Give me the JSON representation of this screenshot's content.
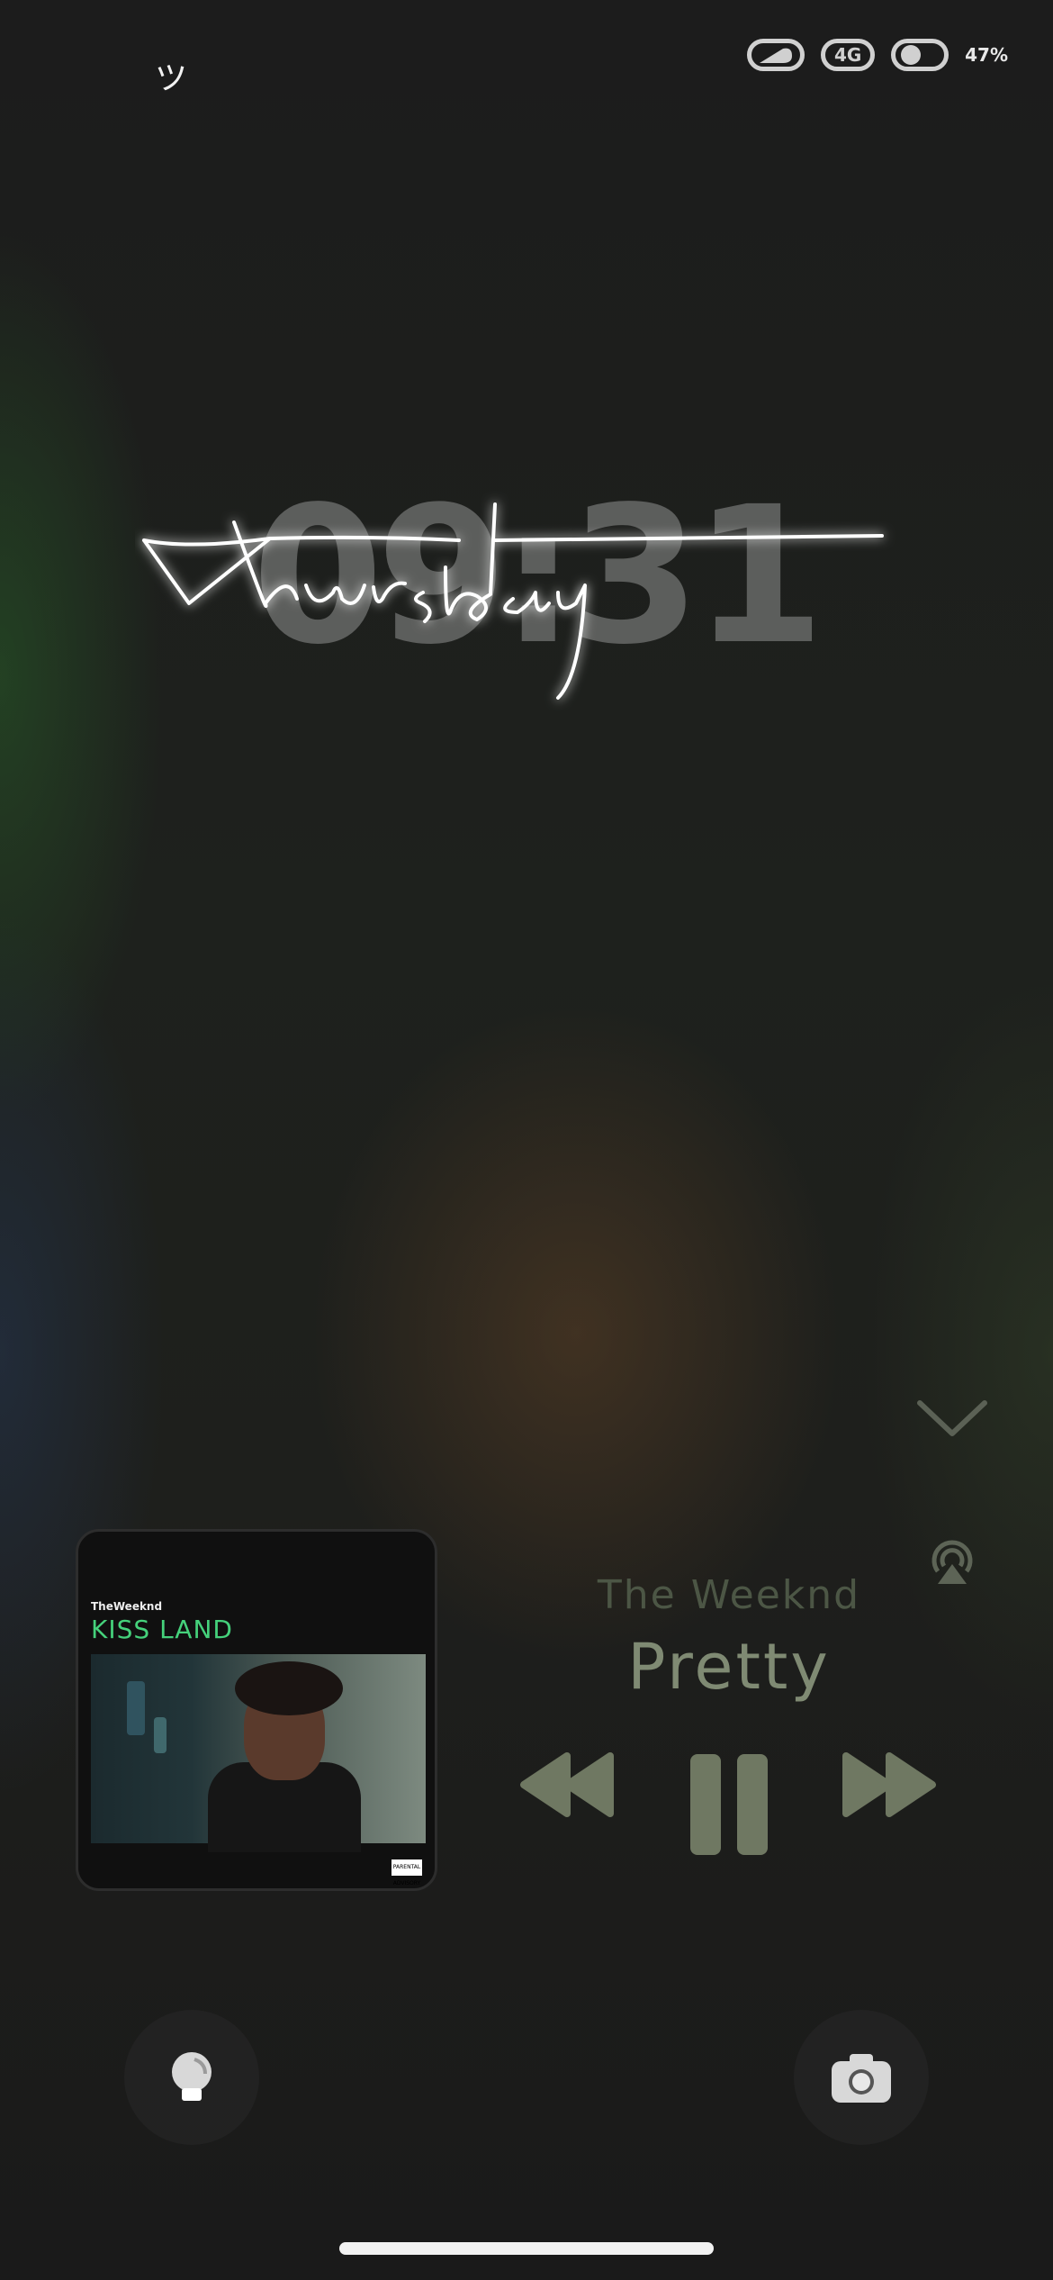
{
  "status": {
    "left_glyph": "ツ",
    "network": "4G",
    "battery": "47%"
  },
  "clock": {
    "time": "09:31",
    "day": "Thursday"
  },
  "media": {
    "album": {
      "artist_small": "TheWeeknd",
      "title": "KISS LAND",
      "advisory": "PARENTAL ADVISORY"
    },
    "artist": "The Weeknd",
    "track": "Pretty",
    "controls": [
      "rewind-icon",
      "pause-icon",
      "fast-forward-icon"
    ],
    "accent": "#7f8a73"
  },
  "shortcuts": [
    "flashlight-icon",
    "camera-icon"
  ]
}
